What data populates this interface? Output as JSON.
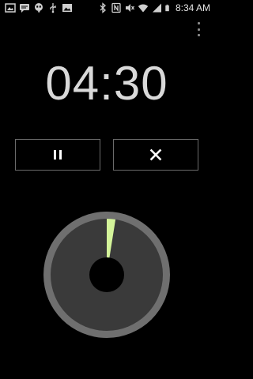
{
  "status_bar": {
    "time": "8:34 AM",
    "left_icons": [
      "picture-icon",
      "chat-icon",
      "hangouts-icon",
      "usb-icon",
      "image-icon"
    ],
    "right_icons": [
      "bluetooth-icon",
      "nfc-icon",
      "mute-icon",
      "wifi-icon",
      "signal-icon",
      "battery-icon"
    ]
  },
  "timer": {
    "remaining": "04:30",
    "progress_fraction": 0.025
  },
  "controls": {
    "pause_icon": "pause-icon",
    "cancel_icon": "close-icon"
  },
  "colors": {
    "background": "#000000",
    "accent_progress": "#d4f49a",
    "ring": "#6f6f6f",
    "dial_fill": "#3a3a3a"
  }
}
